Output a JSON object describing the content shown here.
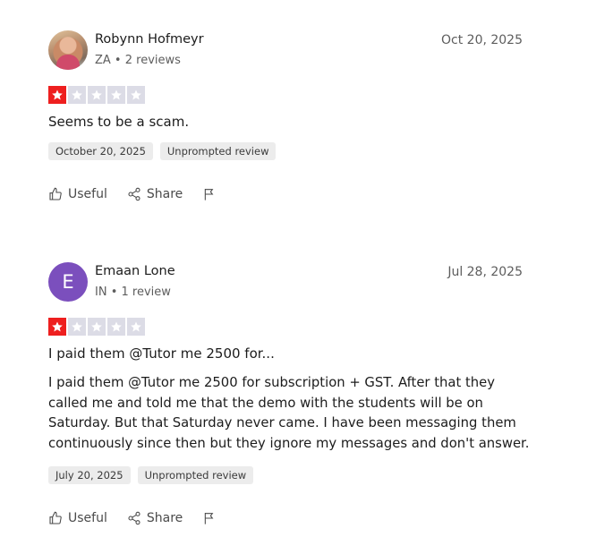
{
  "reviews": [
    {
      "name": "Robynn Hofmeyr",
      "meta": "ZA • 2 reviews",
      "date": "Oct 20, 2025",
      "rating": 1,
      "title": "Seems to be a scam.",
      "body": "",
      "badges": [
        "October 20, 2025",
        "Unprompted review"
      ],
      "actions": {
        "useful": "Useful",
        "share": "Share"
      }
    },
    {
      "name": "Emaan Lone",
      "avatar_letter": "E",
      "meta": "IN • 1 review",
      "date": "Jul 28, 2025",
      "rating": 1,
      "title": "I paid them @Tutor me 2500 for...",
      "body": "I paid them @Tutor me 2500 for subscription + GST. After that they called me and told me that the demo with the students will be on Saturday. But that Saturday never came. I have been messaging them continuously since then but they ignore my messages and don't answer.",
      "badges": [
        "July 20, 2025",
        "Unprompted review"
      ],
      "actions": {
        "useful": "Useful",
        "share": "Share"
      }
    }
  ],
  "colors": {
    "star_on": "#ee1f1f",
    "star_off": "#dcdce6",
    "avatar_letter_bg": "#7b4fbd"
  }
}
